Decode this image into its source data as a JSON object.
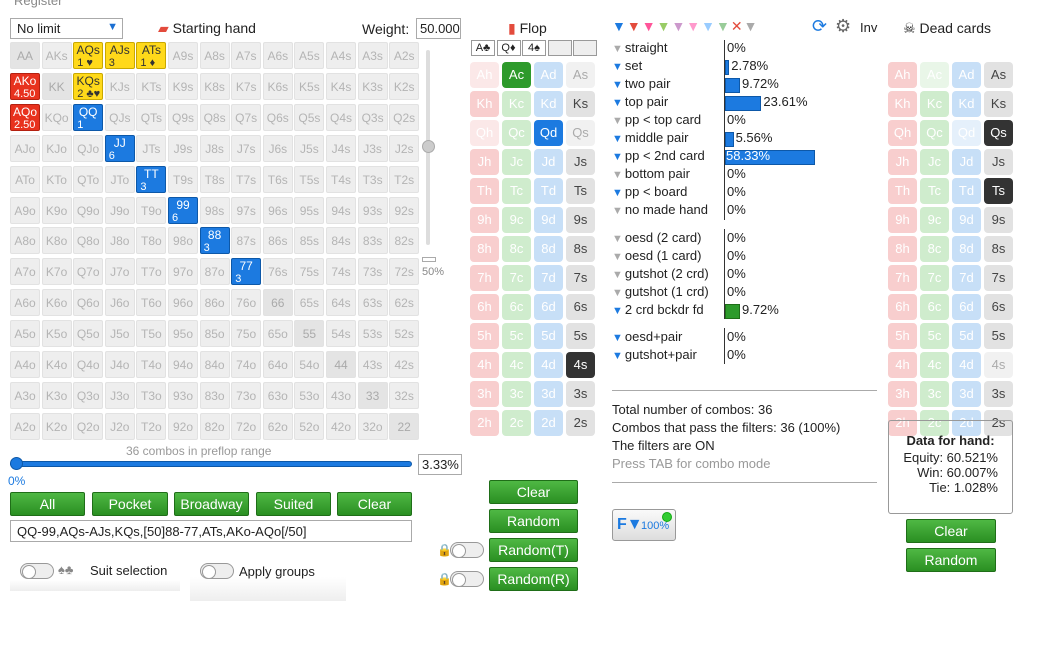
{
  "topbar": {
    "register_label": "Register"
  },
  "range": {
    "limit_select": "No limit",
    "starting_hand_label": "Starting hand",
    "weight_label": "Weight:",
    "weight_value": "50.000",
    "slider_percent": "50%",
    "combo_caption": "36 combos in preflop range",
    "percent_value": "3.33%",
    "percent_min": "0%",
    "buttons": {
      "all": "All",
      "pocket": "Pocket",
      "broadway": "Broadway",
      "suited": "Suited",
      "clear": "Clear"
    },
    "range_text": "QQ-99,AQs-AJs,KQs,[50]88-77,ATs,AKo-AQo[/50]",
    "suit_selection_label": "Suit selection",
    "apply_groups_label": "Apply groups",
    "grid": [
      [
        "AA",
        "AKs",
        "AQs",
        "AJs",
        "ATs",
        "A9s",
        "A8s",
        "A7s",
        "A6s",
        "A5s",
        "A4s",
        "A3s",
        "A2s"
      ],
      [
        "AKo",
        "KK",
        "KQs",
        "KJs",
        "KTs",
        "K9s",
        "K8s",
        "K7s",
        "K6s",
        "K5s",
        "K4s",
        "K3s",
        "K2s"
      ],
      [
        "AQo",
        "KQo",
        "QQ",
        "QJs",
        "QTs",
        "Q9s",
        "Q8s",
        "Q7s",
        "Q6s",
        "Q5s",
        "Q4s",
        "Q3s",
        "Q2s"
      ],
      [
        "AJo",
        "KJo",
        "QJo",
        "JJ",
        "JTs",
        "J9s",
        "J8s",
        "J7s",
        "J6s",
        "J5s",
        "J4s",
        "J3s",
        "J2s"
      ],
      [
        "ATo",
        "KTo",
        "QTo",
        "JTo",
        "TT",
        "T9s",
        "T8s",
        "T7s",
        "T6s",
        "T5s",
        "T4s",
        "T3s",
        "T2s"
      ],
      [
        "A9o",
        "K9o",
        "Q9o",
        "J9o",
        "T9o",
        "99",
        "98s",
        "97s",
        "96s",
        "95s",
        "94s",
        "93s",
        "92s"
      ],
      [
        "A8o",
        "K8o",
        "Q8o",
        "J8o",
        "T8o",
        "98o",
        "88",
        "87s",
        "86s",
        "85s",
        "84s",
        "83s",
        "82s"
      ],
      [
        "A7o",
        "K7o",
        "Q7o",
        "J7o",
        "T7o",
        "97o",
        "87o",
        "77",
        "76s",
        "75s",
        "74s",
        "73s",
        "72s"
      ],
      [
        "A6o",
        "K6o",
        "Q6o",
        "J6o",
        "T6o",
        "96o",
        "86o",
        "76o",
        "66",
        "65s",
        "64s",
        "63s",
        "62s"
      ],
      [
        "A5o",
        "K5o",
        "Q5o",
        "J5o",
        "T5o",
        "95o",
        "85o",
        "75o",
        "65o",
        "55",
        "54s",
        "53s",
        "52s"
      ],
      [
        "A4o",
        "K4o",
        "Q4o",
        "J4o",
        "T4o",
        "94o",
        "84o",
        "74o",
        "64o",
        "54o",
        "44",
        "43s",
        "42s"
      ],
      [
        "A3o",
        "K3o",
        "Q3o",
        "J3o",
        "T3o",
        "93o",
        "83o",
        "73o",
        "63o",
        "53o",
        "43o",
        "33",
        "32s"
      ],
      [
        "A2o",
        "K2o",
        "Q2o",
        "J2o",
        "T2o",
        "92o",
        "82o",
        "72o",
        "62o",
        "52o",
        "42o",
        "32o",
        "22"
      ]
    ],
    "highlights": {
      "AQs": {
        "style": "yellow",
        "count": "1 ♥"
      },
      "AJs": {
        "style": "yellow",
        "count": "3"
      },
      "ATs": {
        "style": "yellow",
        "count": "1 ♦"
      },
      "KQs": {
        "style": "yellow",
        "count": "2 ♣♥"
      },
      "AKo": {
        "style": "red",
        "count": "4.50"
      },
      "AQo": {
        "style": "red",
        "count": "2.50"
      },
      "QQ": {
        "style": "blue",
        "count": "1"
      },
      "JJ": {
        "style": "blue",
        "count": "6"
      },
      "TT": {
        "style": "blue",
        "count": "3"
      },
      "99": {
        "style": "blue",
        "count": "6"
      },
      "88": {
        "style": "blue",
        "count": "3"
      },
      "77": {
        "style": "blue",
        "count": "3"
      }
    }
  },
  "flop": {
    "title": "Flop",
    "slots": [
      "A♣",
      "Q♦",
      "4♠",
      "",
      ""
    ],
    "cards": [
      [
        "Ah",
        "Ac",
        "Ad",
        "As"
      ],
      [
        "Kh",
        "Kc",
        "Kd",
        "Ks"
      ],
      [
        "Qh",
        "Qc",
        "Qd",
        "Qs"
      ],
      [
        "Jh",
        "Jc",
        "Jd",
        "Js"
      ],
      [
        "Th",
        "Tc",
        "Td",
        "Ts"
      ],
      [
        "9h",
        "9c",
        "9d",
        "9s"
      ],
      [
        "8h",
        "8c",
        "8d",
        "8s"
      ],
      [
        "7h",
        "7c",
        "7d",
        "7s"
      ],
      [
        "6h",
        "6c",
        "6d",
        "6s"
      ],
      [
        "5h",
        "5c",
        "5d",
        "5s"
      ],
      [
        "4h",
        "4c",
        "4d",
        "4s"
      ],
      [
        "3h",
        "3c",
        "3d",
        "3s"
      ],
      [
        "2h",
        "2c",
        "2d",
        "2s"
      ]
    ],
    "selected": [
      "Ac",
      "Qd",
      "4s"
    ],
    "buttons": {
      "clear": "Clear",
      "random": "Random",
      "random_t": "Random(T)",
      "random_r": "Random(R)"
    }
  },
  "stats": {
    "inv_label": "Inv",
    "made_hands": [
      {
        "label": "straight",
        "value": "0%"
      },
      {
        "label": "set",
        "value": "2.78%"
      },
      {
        "label": "two pair",
        "value": "9.72%"
      },
      {
        "label": "top pair",
        "value": "23.61%"
      },
      {
        "label": "pp < top card",
        "value": "0%"
      },
      {
        "label": "middle pair",
        "value": "5.56%"
      },
      {
        "label": "pp < 2nd card",
        "value": "58.33%"
      },
      {
        "label": "bottom pair",
        "value": "0%"
      },
      {
        "label": "pp < board",
        "value": "0%"
      },
      {
        "label": "no made hand",
        "value": "0%"
      }
    ],
    "draws": [
      {
        "label": "oesd (2 card)",
        "value": "0%"
      },
      {
        "label": "oesd (1 card)",
        "value": "0%"
      },
      {
        "label": "gutshot (2 crd)",
        "value": "0%"
      },
      {
        "label": "gutshot (1 crd)",
        "value": "0%"
      },
      {
        "label": "2 crd bckdr fd",
        "value": "9.72%"
      }
    ],
    "combos": [
      {
        "label": "oesd+pair",
        "value": "0%"
      },
      {
        "label": "gutshot+pair",
        "value": "0%"
      }
    ],
    "total_combos": "Total number of combos: 36",
    "pass_filters": "Combos that pass the filters: 36 (100%)",
    "filters_on": "The filters are ON",
    "tab_hint": "Press TAB for combo mode",
    "filter_badge": "100%"
  },
  "dead": {
    "title": "Dead cards",
    "cards": [
      [
        "Ah",
        "Ac",
        "Ad",
        "As"
      ],
      [
        "Kh",
        "Kc",
        "Kd",
        "Ks"
      ],
      [
        "Qh",
        "Qc",
        "Qd",
        "Qs"
      ],
      [
        "Jh",
        "Jc",
        "Jd",
        "Js"
      ],
      [
        "Th",
        "Tc",
        "Td",
        "Ts"
      ],
      [
        "9h",
        "9c",
        "9d",
        "9s"
      ],
      [
        "8h",
        "8c",
        "8d",
        "8s"
      ],
      [
        "7h",
        "7c",
        "7d",
        "7s"
      ],
      [
        "6h",
        "6c",
        "6d",
        "6s"
      ],
      [
        "5h",
        "5c",
        "5d",
        "5s"
      ],
      [
        "4h",
        "4c",
        "4d",
        "4s"
      ],
      [
        "3h",
        "3c",
        "3d",
        "3s"
      ],
      [
        "2h",
        "2c",
        "2d",
        "2s"
      ]
    ],
    "selected": [
      "Qs",
      "Ts"
    ],
    "data_title": "Data for hand:",
    "equity": "Equity: 60.521%",
    "win": "Win: 60.007%",
    "tie": "Tie: 1.028%",
    "buttons": {
      "clear": "Clear",
      "random": "Random"
    }
  }
}
